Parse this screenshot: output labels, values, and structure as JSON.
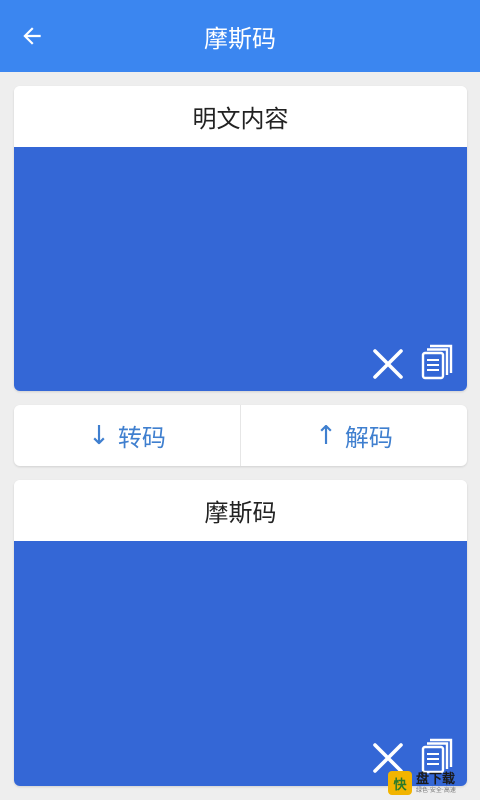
{
  "appbar": {
    "title": "摩斯码",
    "back_icon": "arrow-left-icon",
    "color": "#3b86f0"
  },
  "input_card": {
    "header": "明文内容",
    "value": "",
    "clear_icon": "close-icon",
    "copy_icon": "copy-icon"
  },
  "actions": {
    "encode": {
      "arrow": "↓",
      "label": "转码"
    },
    "decode": {
      "arrow": "↑",
      "label": "解码"
    },
    "text_color": "#3f7fcf"
  },
  "output_card": {
    "header": "摩斯码",
    "value": "",
    "clear_icon": "close-icon",
    "copy_icon": "copy-icon"
  },
  "colors": {
    "text_area_bg": "#3467d6",
    "page_bg": "#eeeeee"
  },
  "watermark": {
    "logo_char": "快",
    "main": "盘下载",
    "sub": "绿色·安全·高速"
  }
}
